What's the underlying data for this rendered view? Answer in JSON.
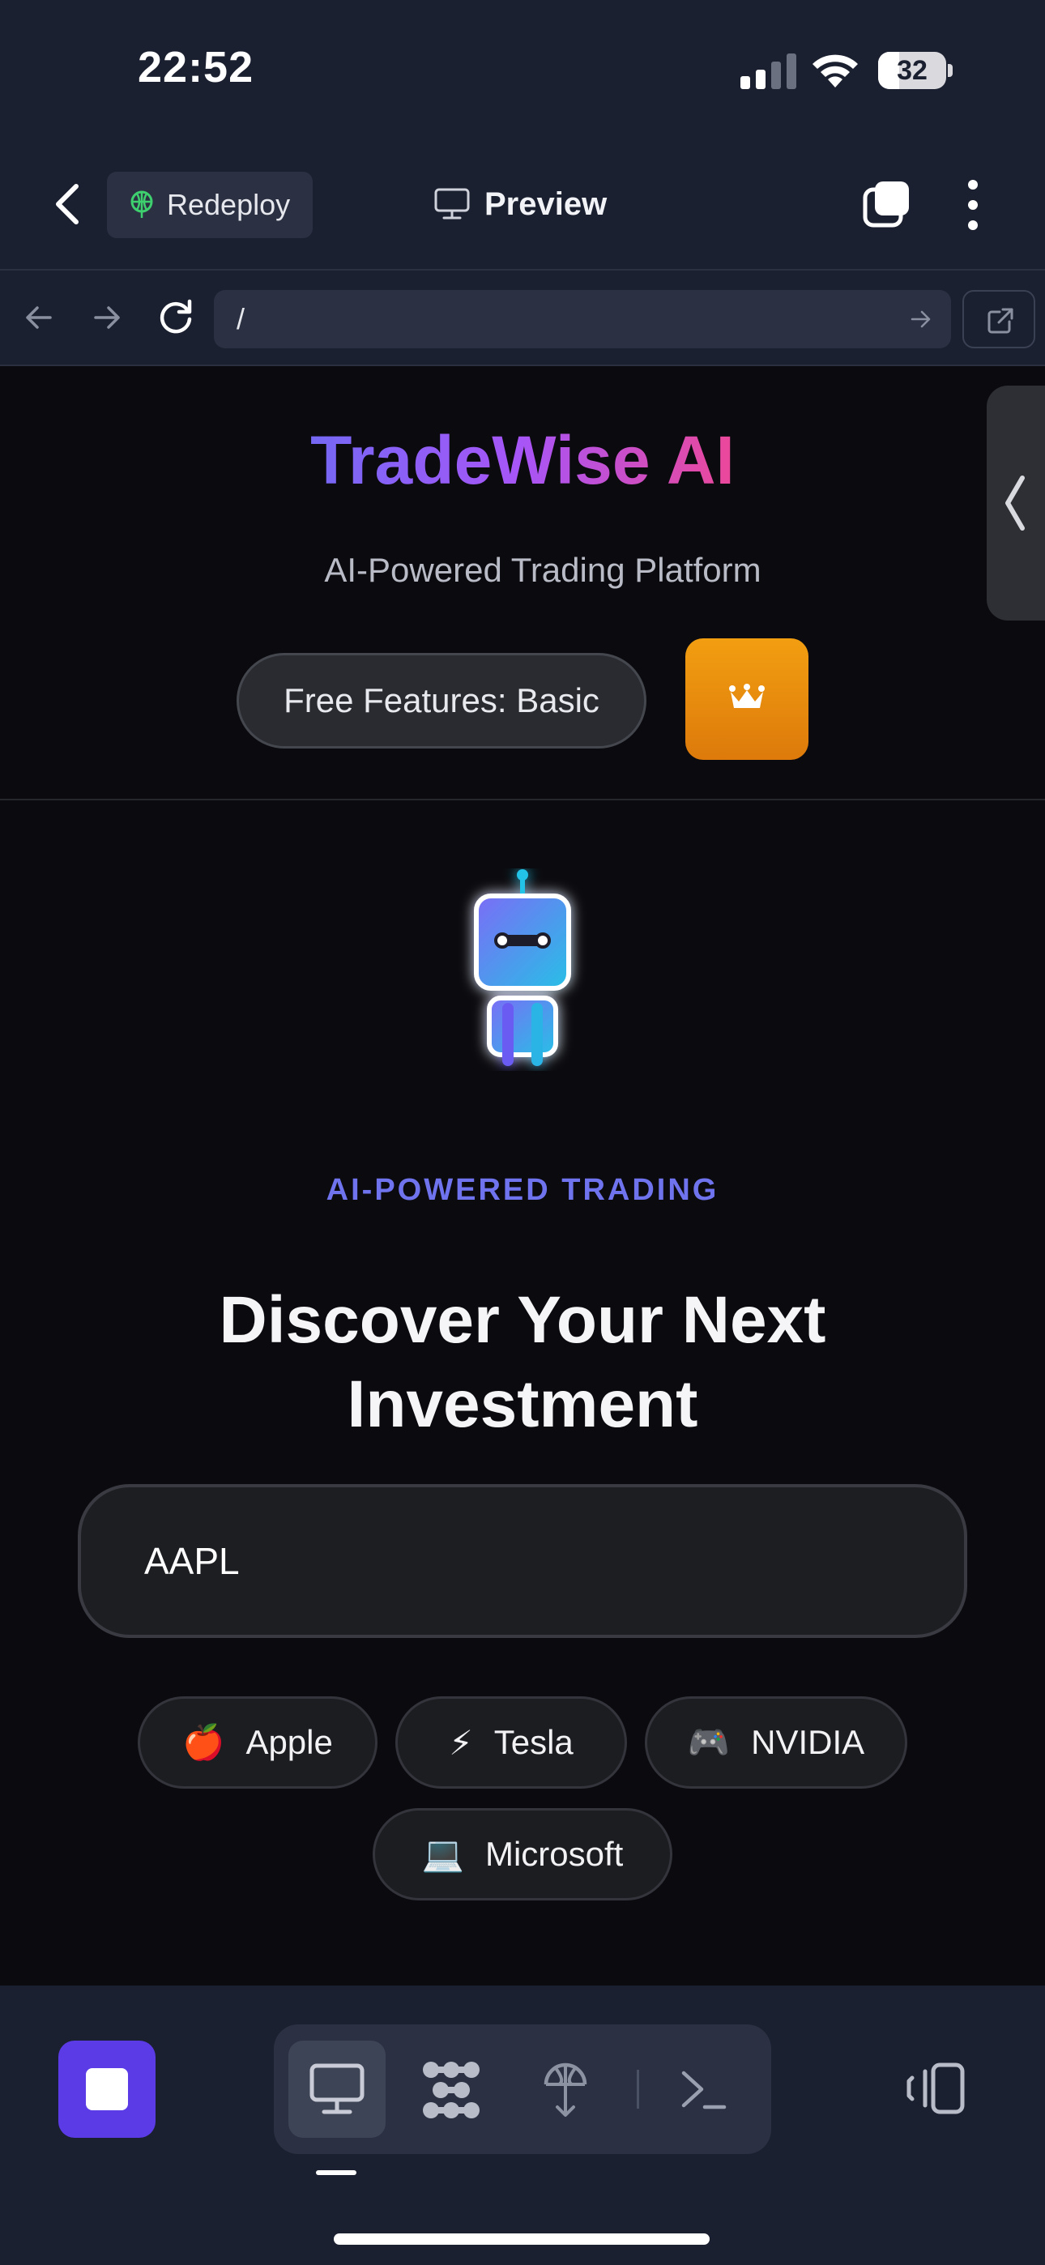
{
  "status_bar": {
    "time": "22:52",
    "battery": "32"
  },
  "header": {
    "redeploy_label": "Redeploy",
    "title": "Preview"
  },
  "browser": {
    "url": "/"
  },
  "app": {
    "title": "TradeWise AI",
    "subtitle": "AI-Powered Trading Platform",
    "features_label": "Free Features: Basic",
    "tagline": "AI-POWERED TRADING",
    "headline_line1": "Discover Your Next",
    "headline_line2": "Investment",
    "search_value": "AAPL",
    "chips": [
      {
        "emoji": "🍎",
        "label": "Apple"
      },
      {
        "emoji": "⚡",
        "label": "Tesla"
      },
      {
        "emoji": "🎮",
        "label": "NVIDIA"
      },
      {
        "emoji": "💻",
        "label": "Microsoft"
      }
    ]
  },
  "colors": {
    "header_bg": "#1b2030",
    "page_bg": "#0b0b0f",
    "accent_purple": "#6f73ee",
    "premium_orange": "#f29e11",
    "stop_button": "#5a3be6"
  },
  "icons": {
    "header": [
      "chevron-left-icon",
      "globe-deploy-icon",
      "monitor-icon",
      "tabs-icon",
      "more-vertical-icon"
    ],
    "browser": [
      "arrow-left-icon",
      "arrow-right-icon",
      "reload-icon",
      "go-arrow-icon",
      "external-link-icon"
    ],
    "page": [
      "crown-icon",
      "chevron-left-icon",
      "robot-icon"
    ],
    "toolbar": [
      "stop-icon",
      "desktop-icon",
      "cluster-icon",
      "deploy-icon",
      "terminal-icon",
      "layout-toggle-icon"
    ]
  }
}
